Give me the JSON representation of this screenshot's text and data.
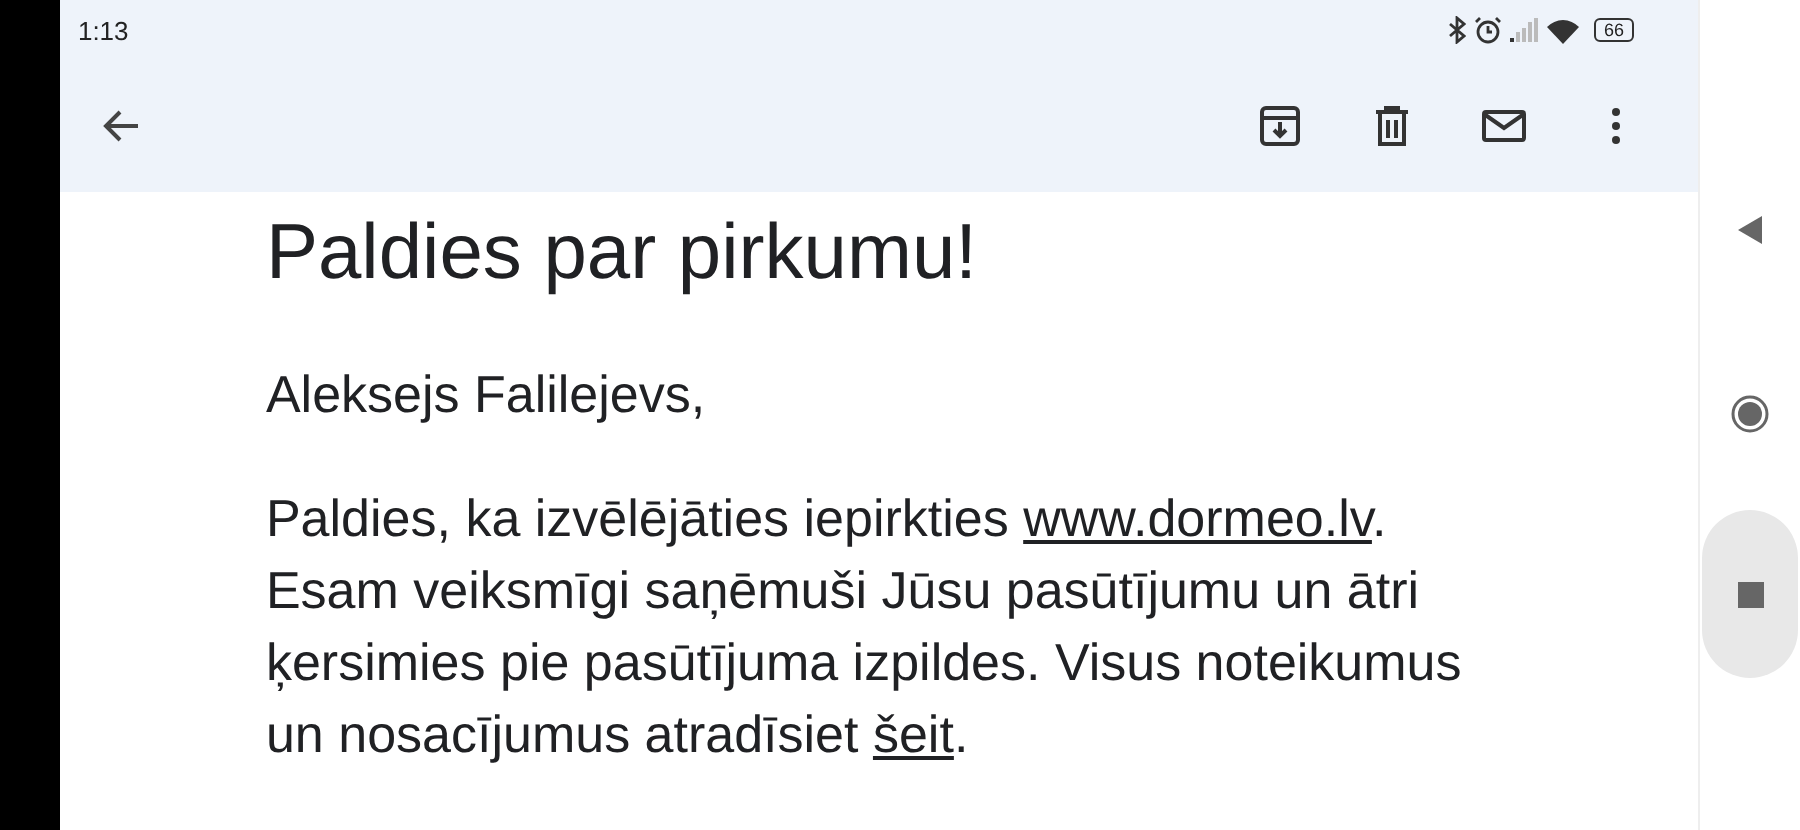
{
  "status_bar": {
    "time": "1:13",
    "battery": "66"
  },
  "toolbar": {
    "actions": [
      {
        "kind": "archive"
      },
      {
        "kind": "delete"
      },
      {
        "kind": "unread"
      },
      {
        "kind": "more"
      }
    ]
  },
  "email": {
    "heading": "Paldies par pirkumu!",
    "greeting": "Aleksejs Falilejevs,",
    "paragraph": [
      {
        "kind": "text",
        "text": "Paldies, ka izvēlējāties iepirkties "
      },
      {
        "kind": "link",
        "text": "www.dormeo.lv"
      },
      {
        "kind": "text",
        "text": ". Esam veiksmīgi saņēmuši Jūsu pasūtījumu un ātri ķersimies pie pasūtījuma izpildes. Visus noteikumus un nosacījumus atradīsiet "
      },
      {
        "kind": "link",
        "text": "šeit"
      },
      {
        "kind": "text",
        "text": "."
      }
    ]
  },
  "nav_bar": {
    "buttons": [
      {
        "kind": "back"
      },
      {
        "kind": "home"
      },
      {
        "kind": "recents",
        "selected": true
      }
    ]
  }
}
